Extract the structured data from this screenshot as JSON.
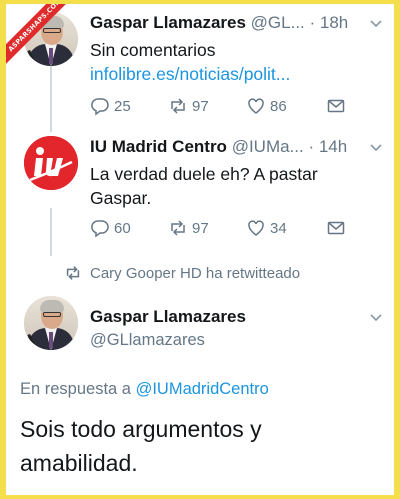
{
  "watermark": {
    "text": "ASPARSHAPS.COM"
  },
  "tweet1": {
    "name": "Gaspar Llamazares",
    "handle_time": "@GL... · 18h",
    "text": "Sin comentarios ",
    "link": "infolibre.es/noticias/polit...",
    "replies": "25",
    "retweets": "97",
    "likes": "86"
  },
  "tweet2": {
    "name": "IU Madrid Centro",
    "handle_time": "@IUMa... · 14h",
    "text": "La verdad duele eh? A pastar Gaspar.",
    "replies": "60",
    "retweets": "97",
    "likes": "34"
  },
  "retweet_banner": {
    "text": "Cary Gooper HD ha retwitteado"
  },
  "tweet3": {
    "name": "Gaspar Llamazares",
    "handle": "@GLlamazares",
    "reply_prefix": "En respuesta a ",
    "reply_target": "@IUMadridCentro",
    "text": "Sois todo argumentos y amabilidad."
  },
  "colors": {
    "link": "#1b95e0",
    "muted": "#657786",
    "border": "#f4de4c",
    "iu_red": "#e3252c"
  }
}
